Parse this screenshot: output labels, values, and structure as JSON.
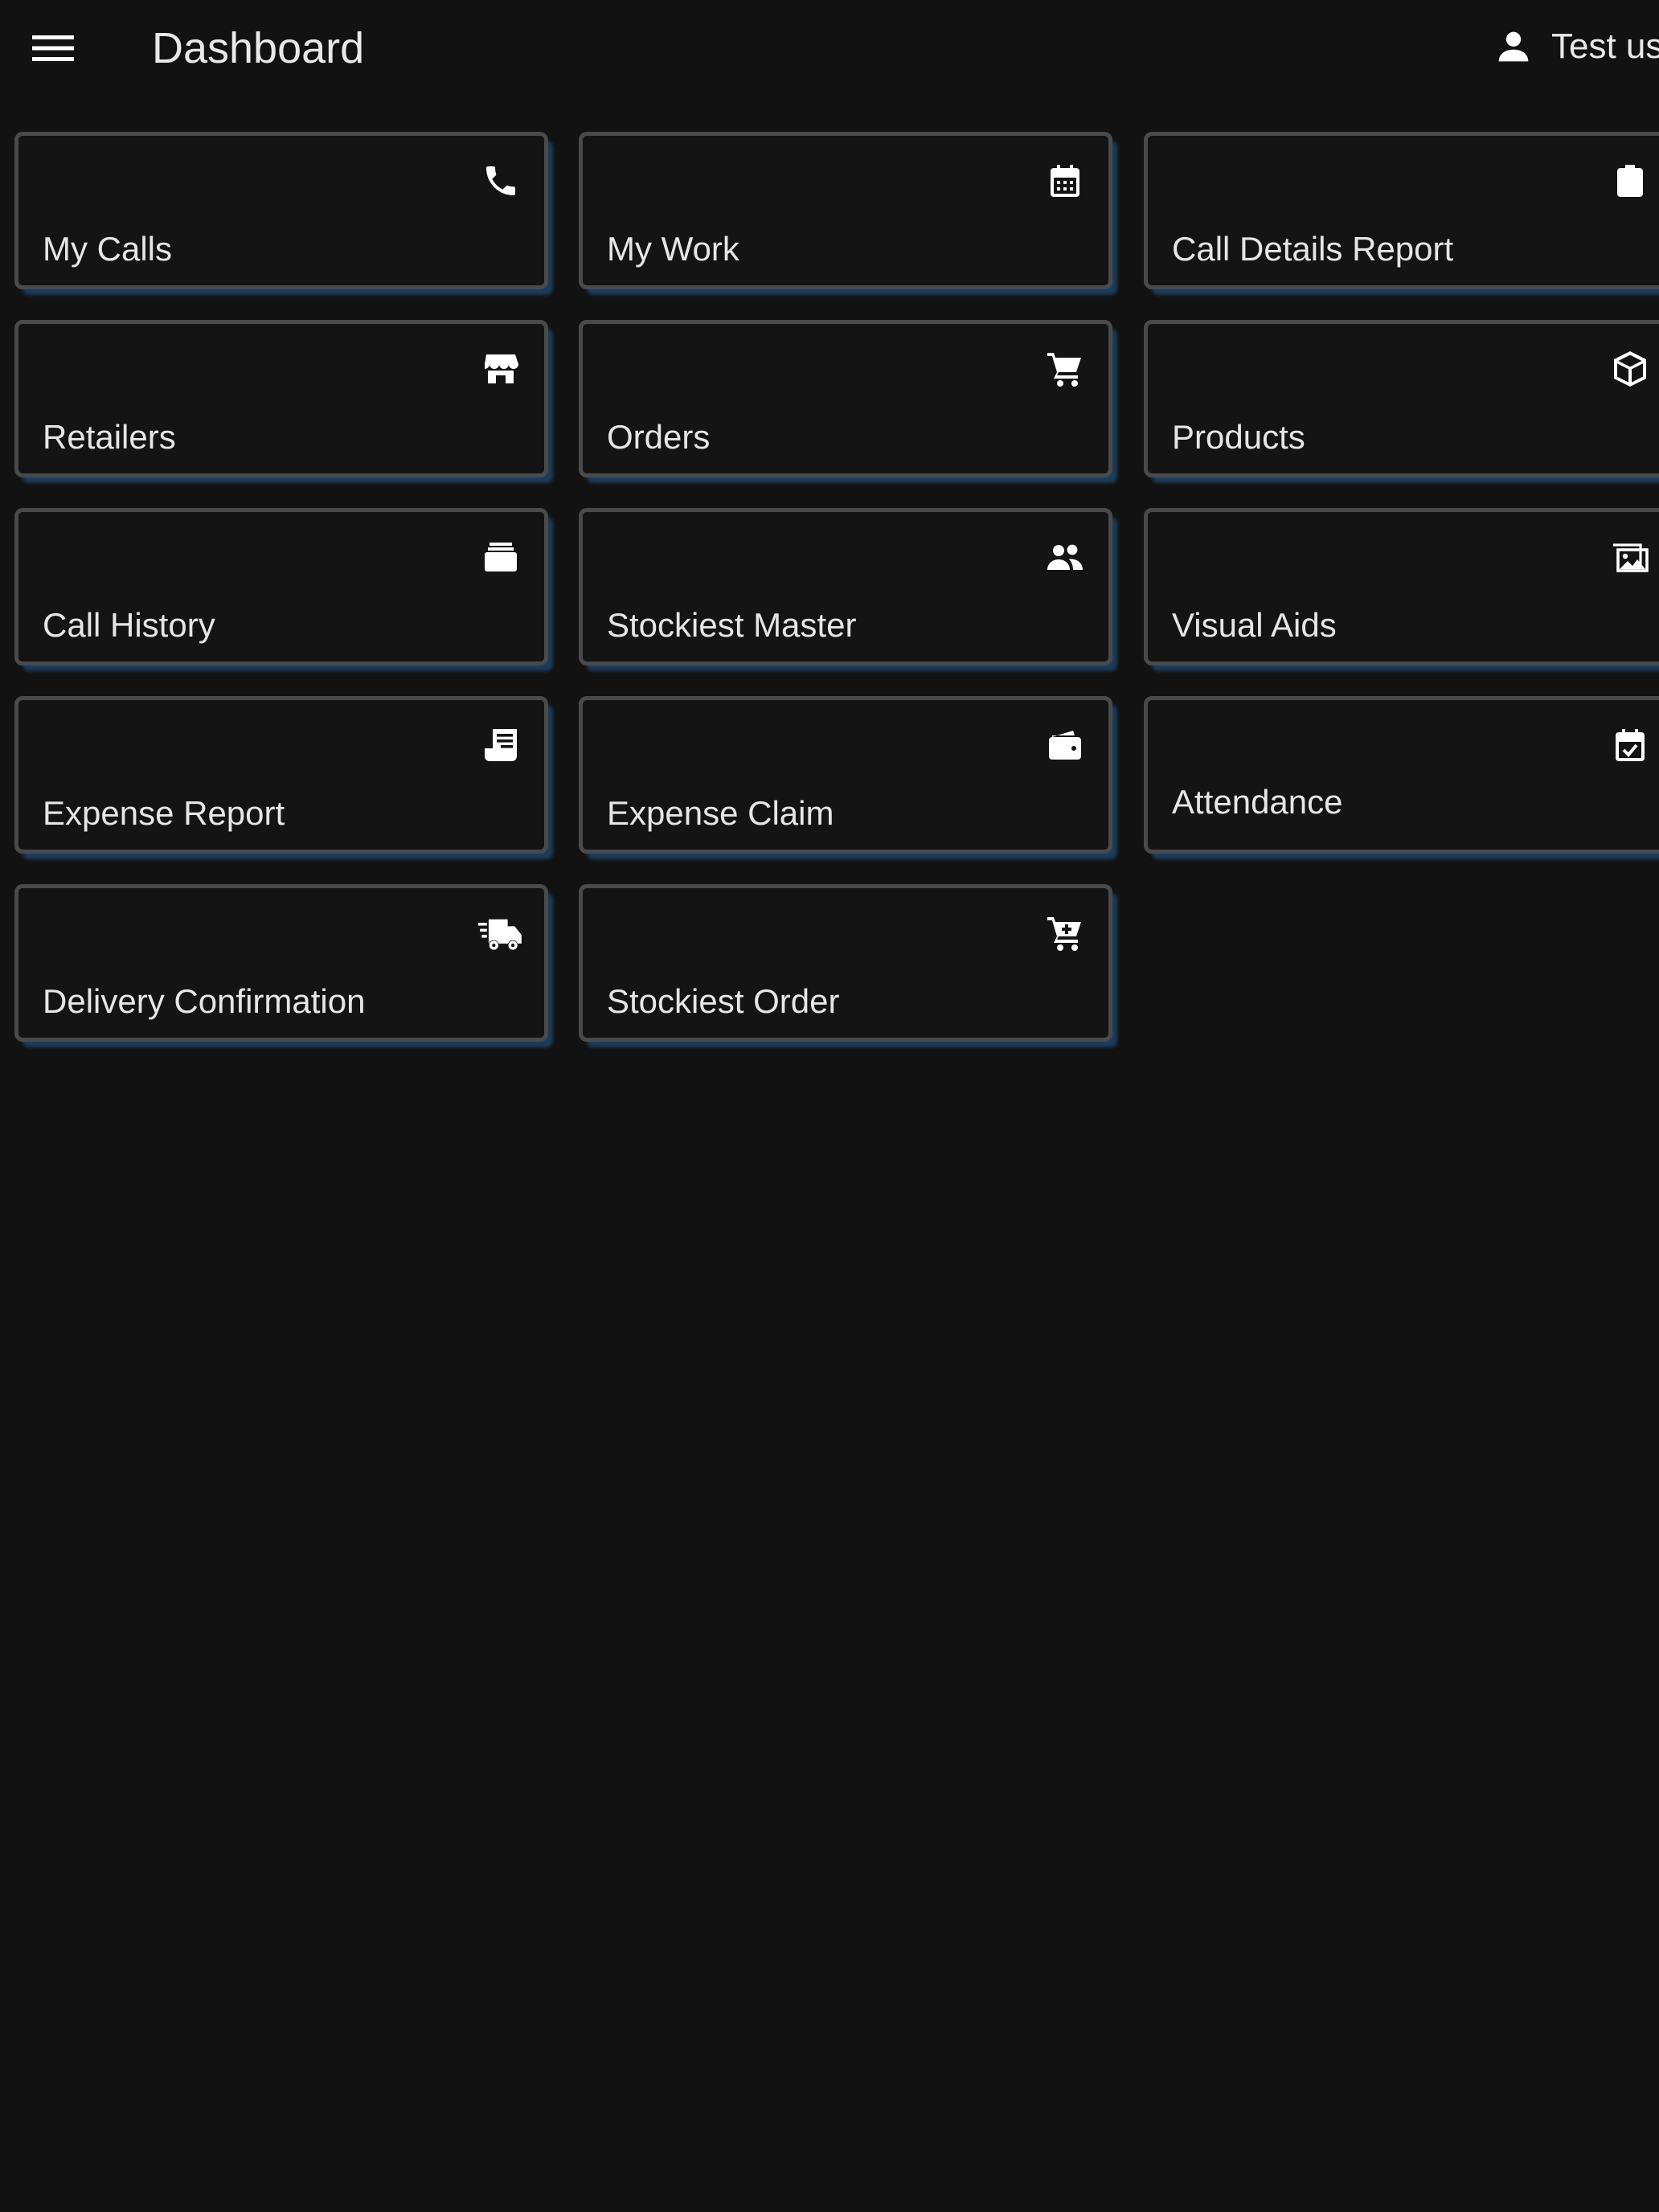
{
  "header": {
    "title": "Dashboard",
    "user_name": "Test us"
  },
  "tiles": [
    {
      "label": "My Calls",
      "icon": "phone-icon"
    },
    {
      "label": "My Work",
      "icon": "calendar-icon"
    },
    {
      "label": "Call Details Report",
      "icon": "clipboard-icon"
    },
    {
      "label": "Retailers",
      "icon": "store-icon"
    },
    {
      "label": "Orders",
      "icon": "cart-icon"
    },
    {
      "label": "Products",
      "icon": "cube-icon"
    },
    {
      "label": "Call History",
      "icon": "archive-icon"
    },
    {
      "label": "Stockiest Master",
      "icon": "people-icon"
    },
    {
      "label": "Visual Aids",
      "icon": "images-icon"
    },
    {
      "label": "Expense Report",
      "icon": "receipt-icon"
    },
    {
      "label": "Expense Claim",
      "icon": "wallet-icon"
    },
    {
      "label": "Attendance",
      "icon": "calendar-check-icon"
    },
    {
      "label": "Delivery Confirmation",
      "icon": "delivery-truck-icon"
    },
    {
      "label": "Stockiest Order",
      "icon": "cart-plus-icon"
    }
  ],
  "colors": {
    "background": "#121212",
    "tile_border": "#4a4a4a",
    "tile_shadow": "#1c3c5c",
    "text": "#e6e6e6"
  }
}
